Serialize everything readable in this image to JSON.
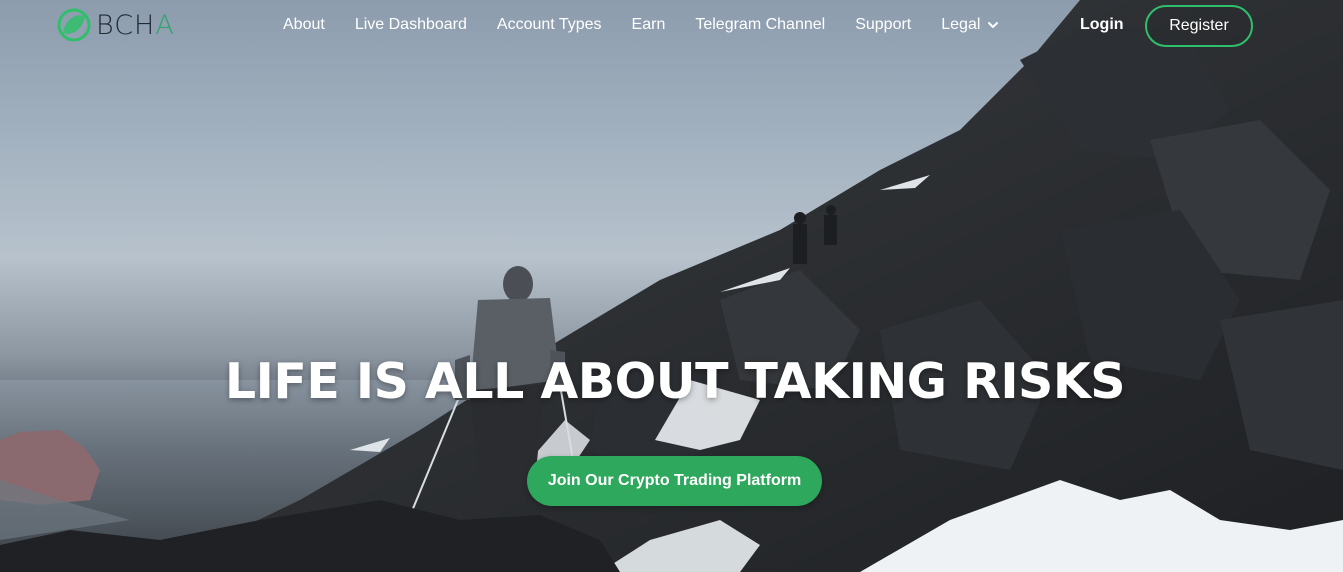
{
  "brand": {
    "logo_text_prefix": "BCH",
    "logo_text_suffix": "A",
    "accent_color": "#2ea85c"
  },
  "nav": {
    "items": [
      {
        "label": "About"
      },
      {
        "label": "Live Dashboard"
      },
      {
        "label": "Account Types"
      },
      {
        "label": "Earn"
      },
      {
        "label": "Telegram Channel"
      },
      {
        "label": "Support"
      },
      {
        "label": "Legal",
        "icon": "chevron-down-icon"
      }
    ],
    "login_label": "Login",
    "register_label": "Register"
  },
  "hero": {
    "headline": "LIFE IS ALL ABOUT TAKING RISKS",
    "cta_label": "Join Our Crypto Trading Platform",
    "background": "hiker-on-snowy-mountain-ridge"
  }
}
